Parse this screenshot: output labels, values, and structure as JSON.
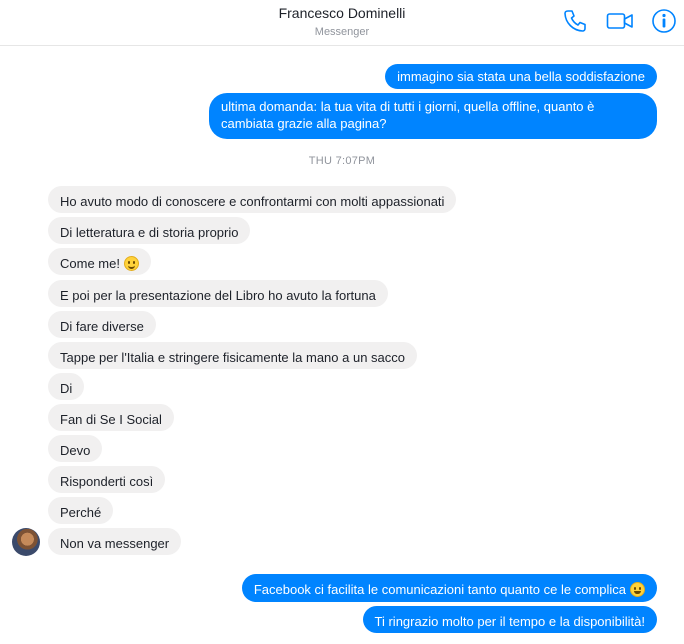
{
  "header": {
    "contact_name": "Francesco Dominelli",
    "subtitle": "Messenger",
    "icons": [
      "phone-icon",
      "video-camera-icon",
      "info-icon"
    ]
  },
  "colors": {
    "accent": "#0084ff",
    "incoming": "#f1f0f0"
  },
  "timestamp": "THU 7:07PM",
  "messages_before": [
    "immagino sia stata una bella soddisfazione",
    "ultima domanda: la tua vita di tutti i giorni, quella offline, quanto è cambiata grazie alla pagina?"
  ],
  "incoming": [
    "Ho avuto modo di conoscere e confrontarmi con molti appassionati",
    "Di letteratura e di storia proprio",
    "Come me!",
    "E poi per la presentazione del Libro ho avuto la fortuna",
    "Di fare diverse",
    "Tappe per l'Italia e stringere fisicamente la mano a un sacco",
    "Di",
    "Fan di Se I Social",
    "Devo",
    "Risponderti così",
    "Perché",
    "Non va messenger"
  ],
  "messages_after": [
    "Facebook ci facilita le comunicazioni tanto quanto ce le complica",
    "Ti ringrazio molto per il tempo e la disponibilità!"
  ]
}
